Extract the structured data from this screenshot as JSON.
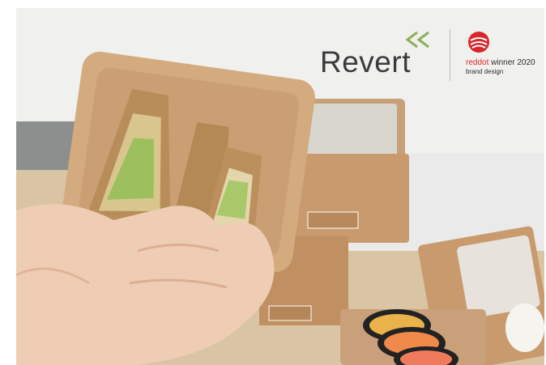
{
  "brand": {
    "name": "Revert",
    "logo_icon": "double-chevron-left-icon",
    "accent_color": "#8cae5a",
    "text_color": "#3a3a3a"
  },
  "award": {
    "icon": "reddot-icon",
    "word_red": "red",
    "word_dot": "dot",
    "suffix": " winner 2020",
    "subtitle": "brand design",
    "color": "#d8262b"
  }
}
